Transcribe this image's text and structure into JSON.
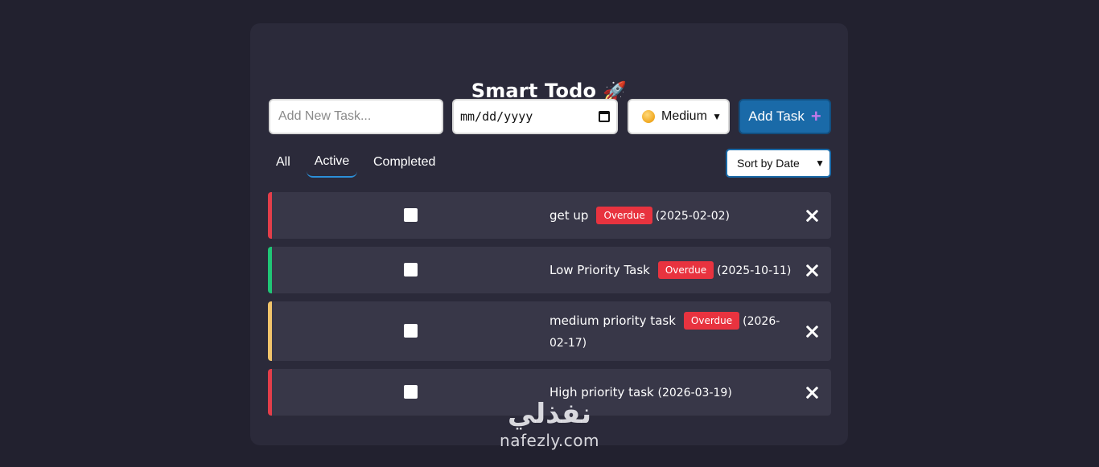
{
  "app": {
    "title": "Smart Todo",
    "title_emoji": "🚀"
  },
  "form": {
    "task_placeholder": "Add New Task...",
    "task_value": "",
    "date_value": "mm/dd/yyyy",
    "priority": {
      "selected": "Medium",
      "icon": "yellow-circle-icon"
    },
    "add_button_label": "Add Task",
    "add_button_icon": "plus-icon"
  },
  "filters": {
    "items": [
      {
        "label": "All"
      },
      {
        "label": "Active",
        "selected": true
      },
      {
        "label": "Completed"
      }
    ]
  },
  "sort": {
    "selected": "Sort by Date"
  },
  "tasks": [
    {
      "title": "get up",
      "badge": "Overdue",
      "date": "(2025-02-02)",
      "priority_color": "#e33e4a",
      "checked": false
    },
    {
      "title": "Low Priority Task",
      "badge": "Overdue",
      "date": "(2025-10-11)",
      "priority_color": "#20c576",
      "checked": false
    },
    {
      "title": "medium priority task",
      "badge": "Overdue",
      "date": "(2026-02-17)",
      "priority_color": "#f1c46b",
      "checked": false
    },
    {
      "title": "High priority task",
      "badge": "",
      "date": "(2026-03-19)",
      "priority_color": "#e33e4a",
      "checked": false
    }
  ],
  "watermark": {
    "arabic": "نفذلي",
    "latin": "nafezly.com"
  },
  "colors": {
    "background": "#22212f",
    "card": "#2b2a3a",
    "task_row": "#383748",
    "accent": "#1a6aa8",
    "overdue_badge": "#e8333f"
  }
}
